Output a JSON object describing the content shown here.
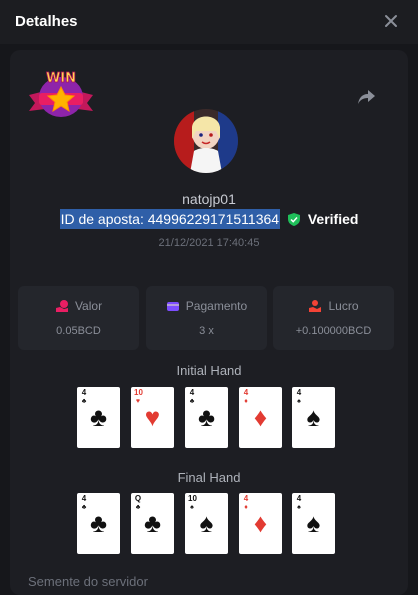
{
  "header": {
    "title": "Detalhes"
  },
  "badge": {
    "text": "WIN"
  },
  "player": {
    "username": "natojp01",
    "bet_id": "ID de aposta: 44996229171511364",
    "verified_label": "Verified",
    "timestamp": "21/12/2021 17:40:45"
  },
  "stats": {
    "valor": {
      "label": "Valor",
      "value": "0.05BCD"
    },
    "pagamento": {
      "label": "Pagamento",
      "value": "3 x"
    },
    "lucro": {
      "label": "Lucro",
      "value": "+0.100000BCD"
    }
  },
  "initial_hand": {
    "title": "Initial Hand",
    "cards": [
      {
        "rank": "4",
        "suit": "♣",
        "color": "black"
      },
      {
        "rank": "10",
        "suit": "♥",
        "color": "red"
      },
      {
        "rank": "4",
        "suit": "♣",
        "color": "black"
      },
      {
        "rank": "4",
        "suit": "♦",
        "color": "red"
      },
      {
        "rank": "4",
        "suit": "♠",
        "color": "black"
      }
    ]
  },
  "final_hand": {
    "title": "Final Hand",
    "cards": [
      {
        "rank": "4",
        "suit": "♣",
        "color": "black"
      },
      {
        "rank": "Q",
        "suit": "♣",
        "color": "black"
      },
      {
        "rank": "10",
        "suit": "♠",
        "color": "black"
      },
      {
        "rank": "4",
        "suit": "♦",
        "color": "red"
      },
      {
        "rank": "4",
        "suit": "♠",
        "color": "black"
      }
    ]
  },
  "server_seed": {
    "label": "Semente do servidor"
  },
  "colors": {
    "accent_green": "#1fbf5a",
    "highlight": "#2f5fa8",
    "red_suit": "#e23b32"
  }
}
